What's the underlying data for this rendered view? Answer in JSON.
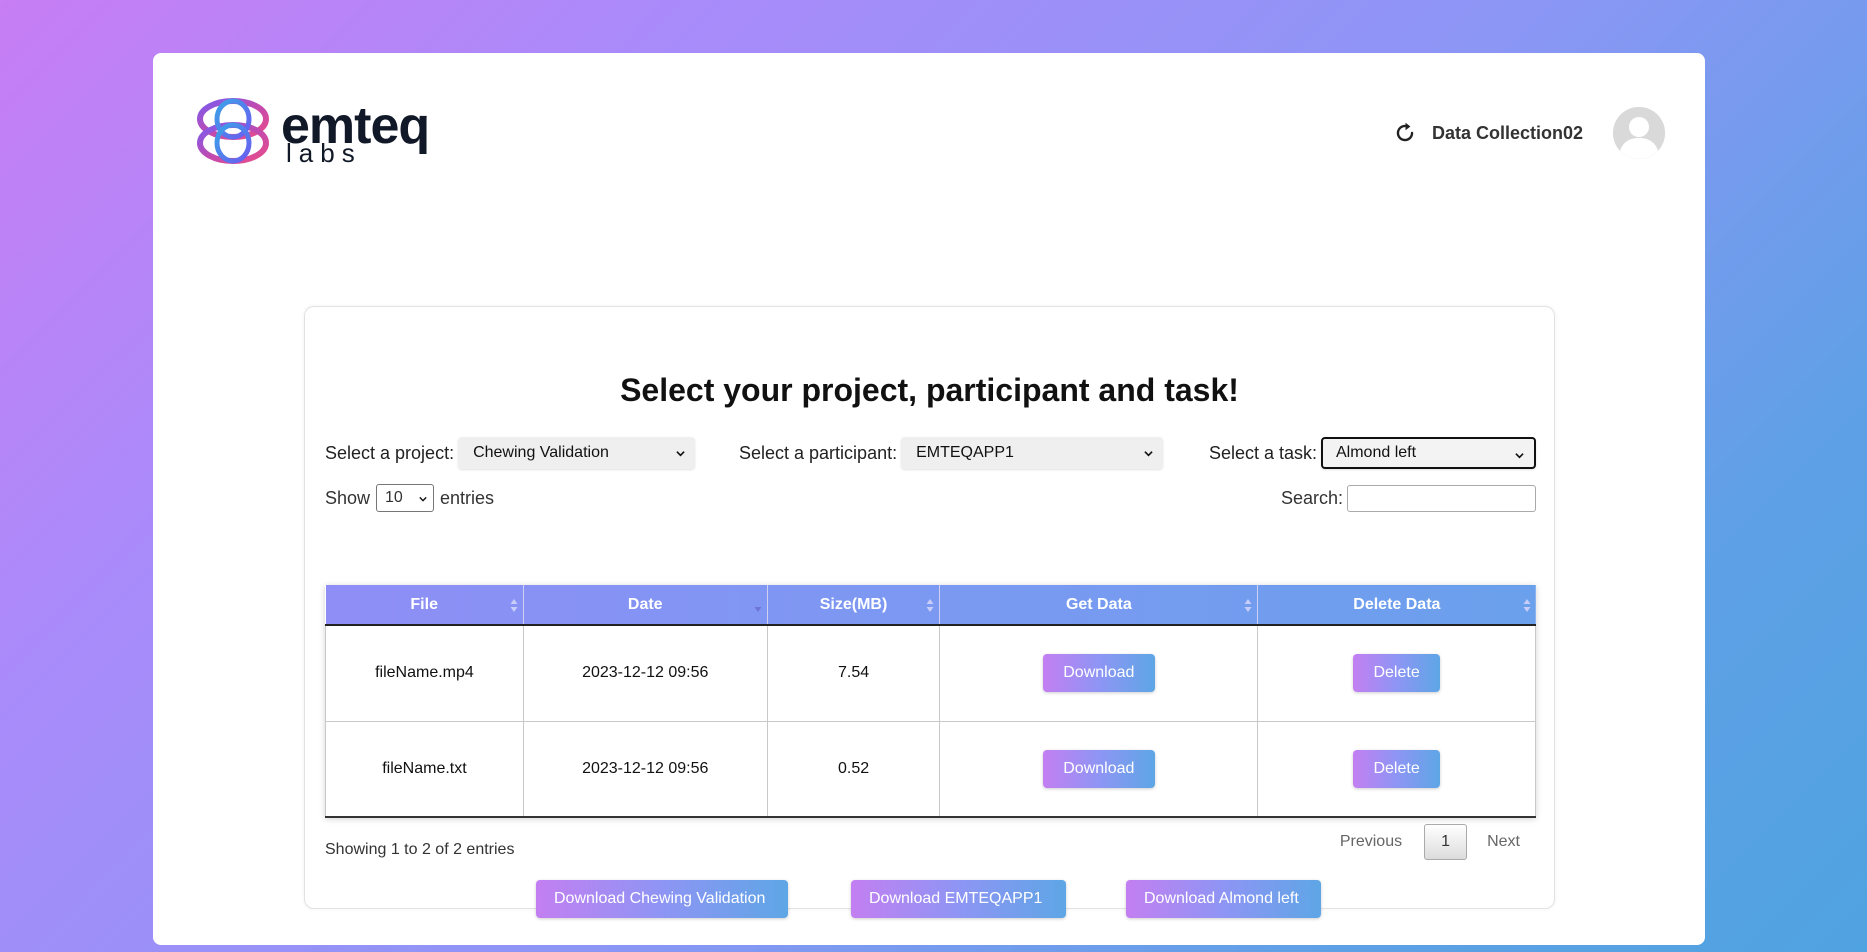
{
  "header": {
    "brand": {
      "name": "emteq",
      "sub": "labs"
    },
    "user_name": "Data Collection02"
  },
  "panel": {
    "title": "Select your project, participant and task!",
    "project": {
      "label": "Select a project:",
      "value": "Chewing Validation"
    },
    "participant": {
      "label": "Select a participant:",
      "value": "EMTEQAPP1"
    },
    "task": {
      "label": "Select a task:",
      "value": "Almond left"
    }
  },
  "table_controls": {
    "show_label": "Show",
    "page_length": "10",
    "entries_label": "entries",
    "search_label": "Search:",
    "search_value": ""
  },
  "table": {
    "columns": [
      "File",
      "Date",
      "Size(MB)",
      "Get Data",
      "Delete Data"
    ],
    "rows": [
      {
        "file": "fileName.mp4",
        "date": "2023-12-12 09:56",
        "size": "7.54",
        "get": "Download",
        "delete": "Delete"
      },
      {
        "file": "fileName.txt",
        "date": "2023-12-12 09:56",
        "size": "0.52",
        "get": "Download",
        "delete": "Delete"
      }
    ]
  },
  "footer": {
    "info": "Showing 1 to 2 of 2 entries",
    "previous": "Previous",
    "current_page": "1",
    "next": "Next"
  },
  "bulk_buttons": {
    "project": "Download Chewing Validation",
    "participant": "Download EMTEQAPP1",
    "task": "Download Almond left"
  },
  "colors": {
    "accent_start": "#c37ff2",
    "accent_end": "#5ea6e6"
  },
  "icons": {
    "refresh": "refresh-icon",
    "avatar": "user-avatar-icon",
    "sort": "sort-icon",
    "dropdown": "chevron-down-icon"
  }
}
